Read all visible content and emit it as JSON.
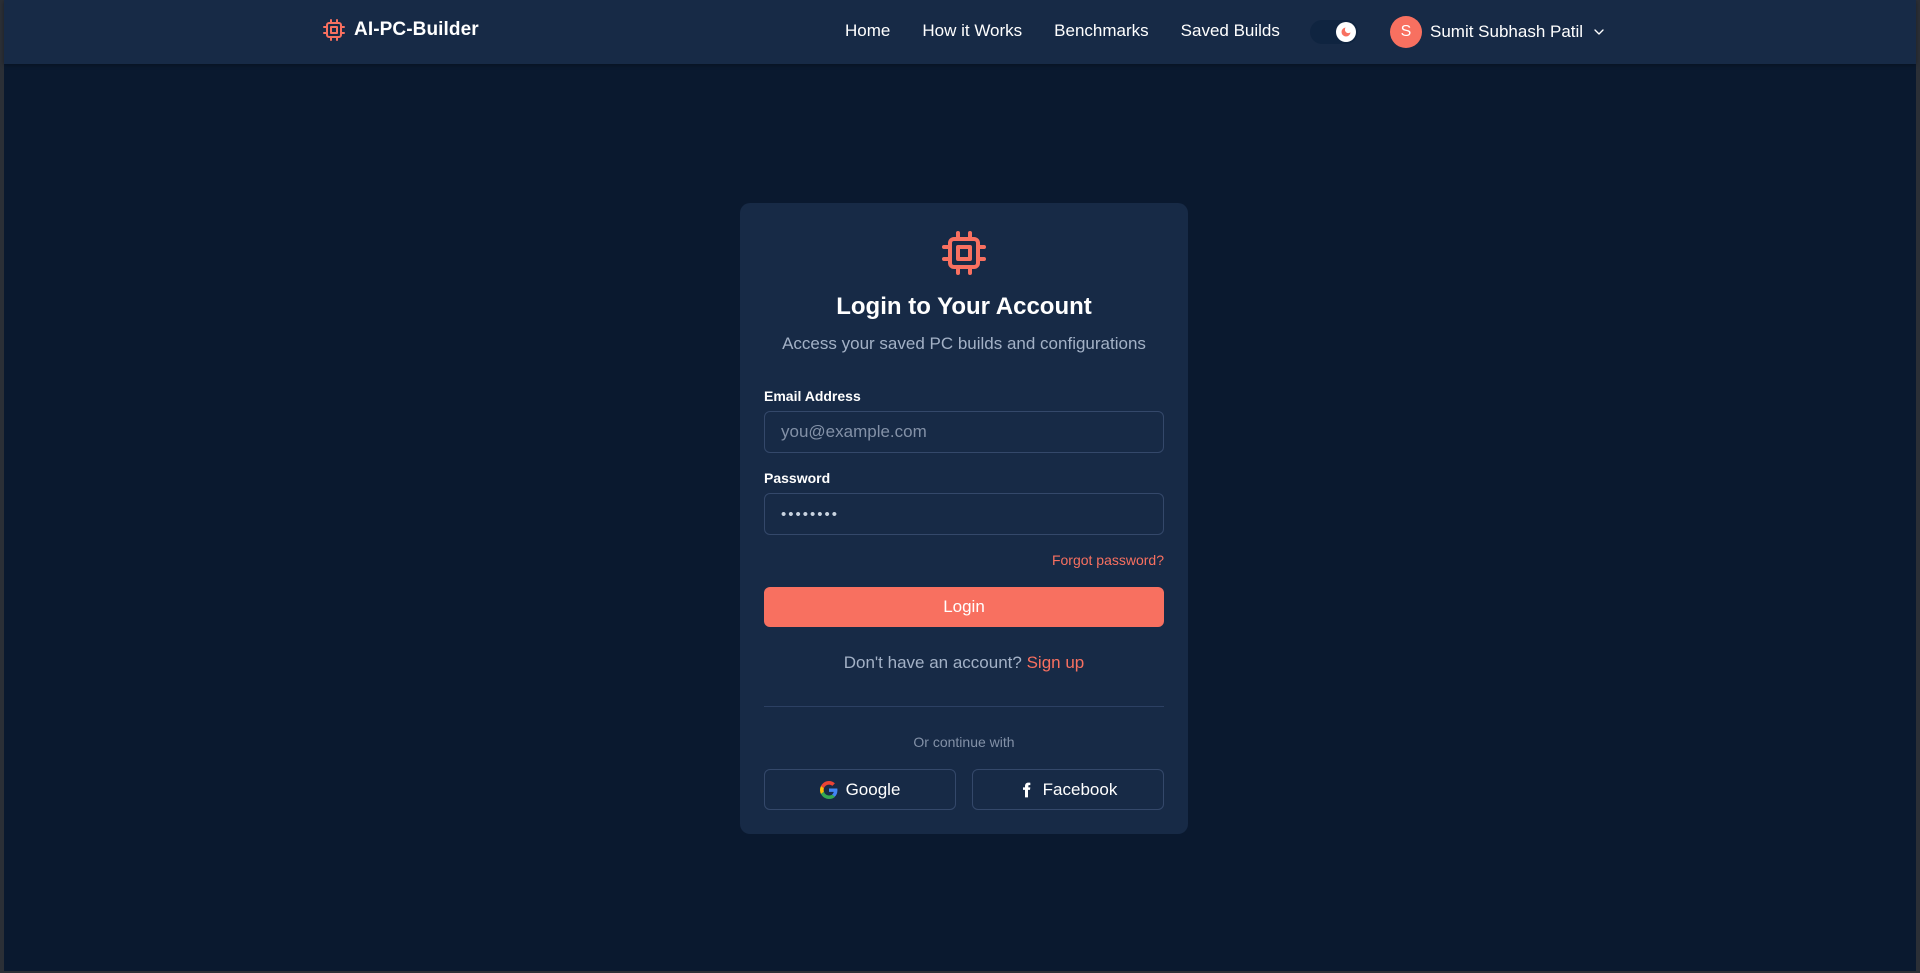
{
  "header": {
    "brand_name": "AI-PC-Builder",
    "brand_icon": "cpu-chip-icon",
    "nav": [
      {
        "label": "Home"
      },
      {
        "label": "How it Works"
      },
      {
        "label": "Benchmarks"
      },
      {
        "label": "Saved Builds"
      }
    ],
    "theme_toggle_icon": "moon-icon",
    "user": {
      "avatar_initial": "S",
      "name": "Sumit Subhash Patil",
      "menu_icon": "chevron-down-icon"
    }
  },
  "login": {
    "logo_icon": "cpu-chip-icon",
    "title": "Login to Your Account",
    "subtitle": "Access your saved PC builds and configurations",
    "email": {
      "label": "Email Address",
      "placeholder": "you@example.com",
      "value": ""
    },
    "password": {
      "label": "Password",
      "value": "••••••••"
    },
    "forgot_password": "Forgot password?",
    "login_button": "Login",
    "no_account_text": "Don't have an account?",
    "signup_link": "Sign up",
    "continue_with": "Or continue with",
    "social": {
      "google_label": "Google",
      "google_icon": "google-icon",
      "facebook_label": "Facebook",
      "facebook_icon": "facebook-icon"
    }
  },
  "colors": {
    "page_background": "#0a192f",
    "surface": "#172a46",
    "accent": "#f87060",
    "muted_text": "#a3b1c6",
    "border": "#34486a"
  }
}
